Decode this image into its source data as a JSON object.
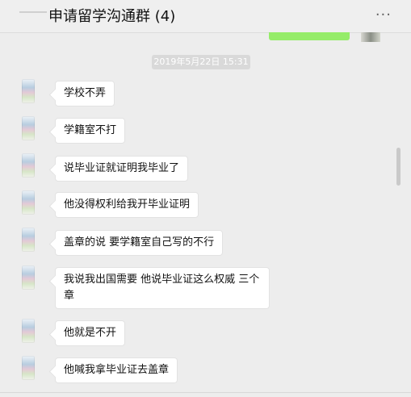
{
  "header": {
    "title": "申请留学沟通群 (4)",
    "more_label": "···",
    "more_icon": "more-icon"
  },
  "timestamp": "2019年5月22日 15:31",
  "messages": [
    {
      "text": "学校不弄"
    },
    {
      "text": "学籍室不打"
    },
    {
      "text": "说毕业证就证明我毕业了"
    },
    {
      "text": "他没得权利给我开毕业证明"
    },
    {
      "text": "盖章的说 要学籍室自己写的不行"
    },
    {
      "text": "我说我出国需要 他说毕业证这么权威 三个章"
    },
    {
      "text": "他就是不开"
    },
    {
      "text": "他喊我拿毕业证去盖章"
    }
  ],
  "colors": {
    "background": "#ededed",
    "sent_bubble": "#95ec69",
    "received_bubble": "#ffffff",
    "timestamp_bg": "#d9d9d9"
  }
}
